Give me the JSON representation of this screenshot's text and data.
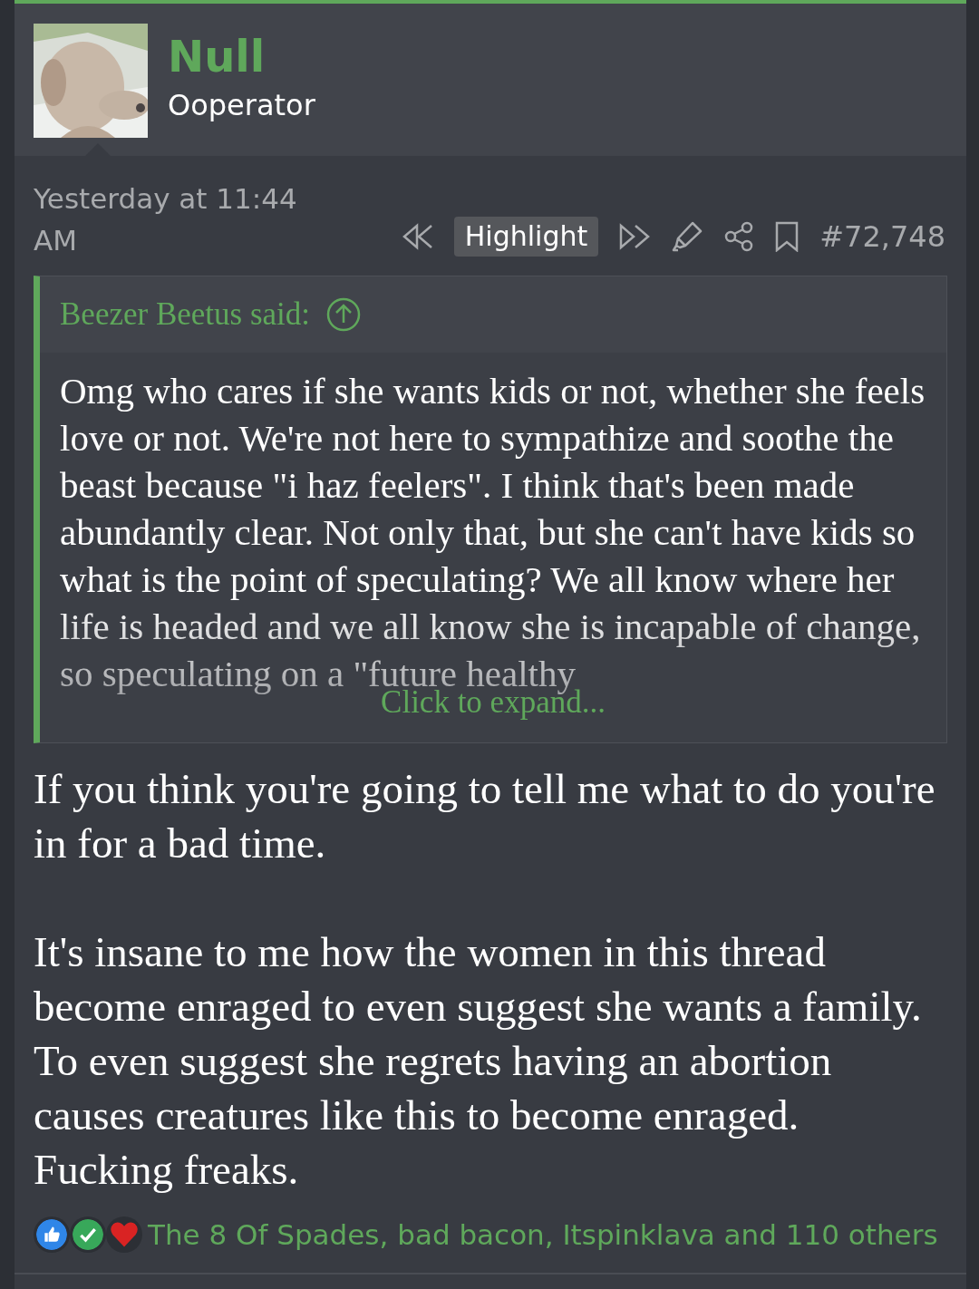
{
  "post": {
    "author": {
      "name": "Null",
      "role": "Ooperator"
    },
    "date": "Yesterday at 11:44 AM",
    "highlight": {
      "label": "Highlight",
      "selected": true
    },
    "post_number": "#72,748",
    "quote": {
      "author": "Beezer Beetus said:",
      "text": "Omg who cares if she wants kids or not, whether she feels love or not. We're not here to sympathize and soothe the beast because \"i haz feelers\". I think that's been made abundantly clear. Not only that, but she can't have kids so what is the point of speculating? We all know where her life is headed and we all know she is incapable of change, so speculating on a \"future healthy",
      "expand": "Click to expand..."
    },
    "paragraphs": [
      "If you think you're going to tell me what to do you're in for a bad time.",
      "It's insane to me how the women in this thread become enraged to even suggest she wants a family. To even suggest she regrets having an abortion causes creatures like this to become enraged. Fucking freaks."
    ],
    "reactions": {
      "icons": [
        {
          "kind": "like"
        },
        {
          "kind": "agree"
        },
        {
          "kind": "love"
        }
      ],
      "summary": "The 8 Of Spades, bad bacon, Itspinklava and 110 others"
    }
  }
}
